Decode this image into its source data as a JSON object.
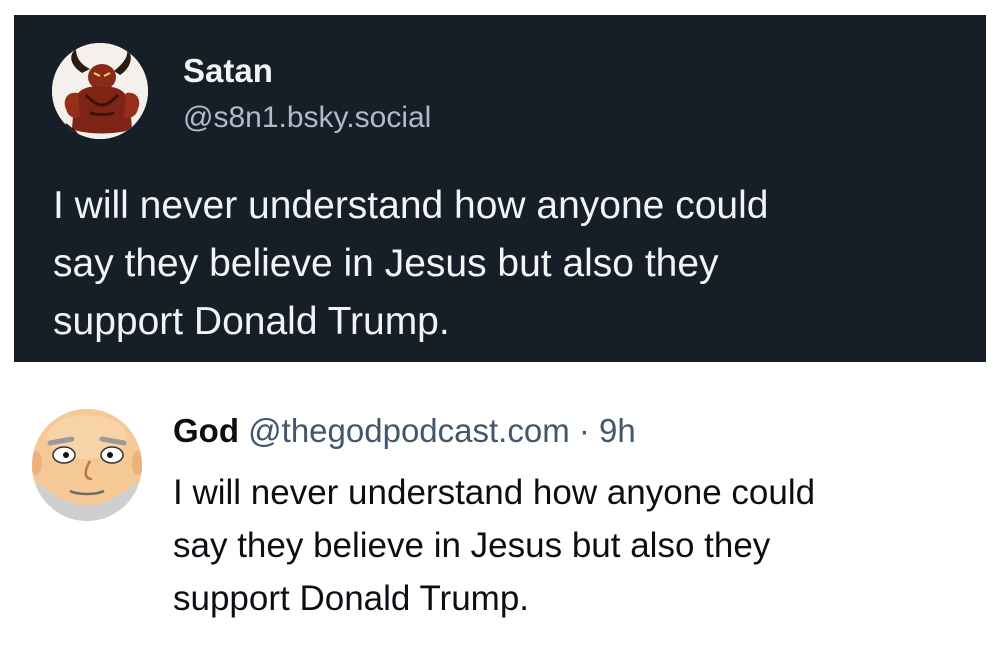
{
  "colors": {
    "dark_background": "#161e27",
    "dark_text": "#f1f3f5",
    "dark_handle": "#aebbc9",
    "light_background": "#ffffff",
    "light_text": "#0b0f14",
    "light_meta": "#42576c"
  },
  "dark_post": {
    "avatar_icon": "horned-demon-avatar",
    "display_name": "Satan",
    "handle": "@s8n1.bsky.social",
    "text": "I will never understand how anyone could\nsay they believe in Jesus but also they\nsupport Donald Trump."
  },
  "light_post": {
    "avatar_icon": "bald-old-man-avatar",
    "display_name": "God",
    "handle": "@thegodpodcast.com",
    "separator": " · ",
    "timestamp": "9h",
    "text": "I will never understand how anyone could\nsay they believe in Jesus but also they\nsupport Donald Trump."
  }
}
